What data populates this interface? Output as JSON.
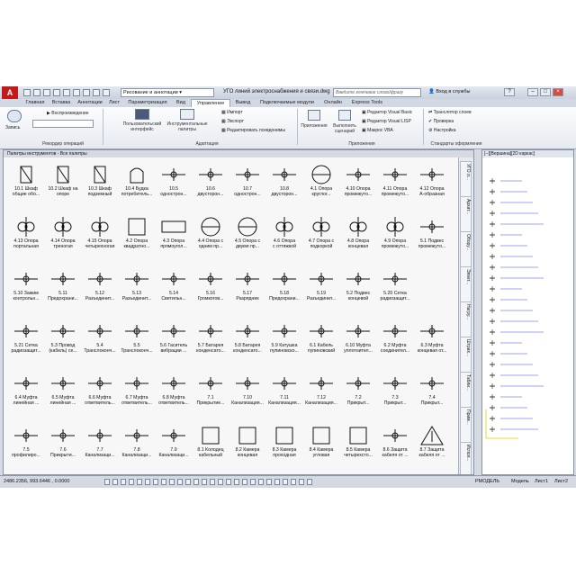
{
  "window": {
    "title": "УГО линий электроснабжения и связи.dwg",
    "workspace": "Рисование и аннотации",
    "search_placeholder": "Введите ключевое слово/фразу",
    "login": "Вход в службы"
  },
  "ribbon_tabs": [
    "Главная",
    "Вставка",
    "Аннотации",
    "Лист",
    "Параметризация",
    "Вид",
    "Управление",
    "Вывод",
    "Подключаемые модули",
    "Онлайн",
    "Express Tools"
  ],
  "active_tab": "Управление",
  "ribbon": {
    "record": "Запись",
    "playback": "Воспроизведение",
    "group_recorder": "Рекордер операций",
    "custom_ui": "Пользовательский интерфейс",
    "tool_palettes": "Инструментальные палитры",
    "import": "Импорт",
    "export": "Экспорт",
    "edit_aliases": "Редактировать псевдонимы",
    "group_adapt": "Адаптация",
    "apps": "Приложения",
    "run_script": "Выполнить сценарий",
    "vb_editor": "Редактор Visual Basic",
    "lisp_editor": "Редактор Visual LISP",
    "vba_macro": "Макрос VBA",
    "group_apps": "Приложения",
    "layer_translator": "Транслятор слоев",
    "check": "Проверка",
    "settings": "Настройка",
    "group_standards": "Стандарты оформления"
  },
  "palette": {
    "title": "Палитры инструментов - Все палитры",
    "side_tabs": [
      "УГО л...",
      "Архит...",
      "Обору...",
      "Элект...",
      "Нагру...",
      "Штрих...",
      "Табли...",
      "Прим...",
      "Испол..."
    ],
    "items": [
      [
        "10.1 Шкаф",
        "общие обо...",
        "box"
      ],
      [
        "10.2 Шкаф на",
        "опоре",
        "box"
      ],
      [
        "10.3 Шкаф",
        "подземный",
        "box"
      ],
      [
        "10.4 Будка",
        "потребитель...",
        "arch"
      ],
      [
        "10.5",
        "однострон...",
        "line"
      ],
      [
        "10.6",
        "двусторон...",
        "line"
      ],
      [
        "10.7",
        "однострон...",
        "line"
      ],
      [
        "10.8",
        "двусторон...",
        "line"
      ],
      [
        "4.1 Опора",
        "круглог...",
        "circle"
      ],
      [
        "4.10 Опора",
        "промежуто...",
        "line"
      ],
      [
        "4.11 Опора",
        "промежуто...",
        "line"
      ],
      [
        "4.12 Опора",
        "А-образная",
        "line"
      ],
      [
        "4.13 Опора",
        "портальная",
        "pole"
      ],
      [
        "4.14 Опора",
        "треногая",
        "pole"
      ],
      [
        "4.15 Опора",
        "четырехногая",
        "pole"
      ],
      [
        "4.2 Опора",
        "квадратно...",
        "square"
      ],
      [
        "4.3 Опора",
        "прямоугол...",
        "rect"
      ],
      [
        "4.4 Опора с",
        "одним пр...",
        "circle"
      ],
      [
        "4.5 Опора с",
        "двумя пр...",
        "circle"
      ],
      [
        "4.6 Опора",
        "с оттяжкой",
        "pole"
      ],
      [
        "4.7 Опора с",
        "подкоркой",
        "pole"
      ],
      [
        "4.8 Опора",
        "концевая",
        "pole"
      ],
      [
        "4.9 Опора",
        "промежуто...",
        "pole"
      ],
      [
        "5.1 Подвес",
        "промежуто...",
        "line"
      ],
      [
        "5.10 Зажим",
        "контрольн...",
        "line"
      ],
      [
        "5.11",
        "Предохрани...",
        "line"
      ],
      [
        "5.12",
        "Разъединит...",
        "line"
      ],
      [
        "5.13",
        "Разъединит...",
        "line"
      ],
      [
        "5.14",
        "Светильн...",
        "line"
      ],
      [
        "5.16",
        "Громкогов...",
        "line"
      ],
      [
        "5.17",
        "Разрядник",
        "line"
      ],
      [
        "5.18",
        "Предохрани...",
        "line"
      ],
      [
        "5.19",
        "Разъединит...",
        "line"
      ],
      [
        "5.2 Подвес",
        "концевой",
        "line"
      ],
      [
        "5.20 Сетка",
        "радиозащит...",
        "line"
      ],
      [
        "",
        "",
        " "
      ],
      [
        "5.21 Сетка",
        "радиозащит...",
        "line"
      ],
      [
        "5.3 Провод",
        "(кабель) се...",
        "line"
      ],
      [
        "5.4",
        "Транслоконч...",
        "line"
      ],
      [
        "5.5",
        "Транслоконч...",
        "line"
      ],
      [
        "5.6 Гаситель",
        "вибрации ...",
        "line"
      ],
      [
        "5.7 Батарея",
        "конденсато...",
        "line"
      ],
      [
        "5.8 Батарея",
        "конденсато...",
        "line"
      ],
      [
        "5.9 Катушка",
        "пупиновско...",
        "line"
      ],
      [
        "6.1 Кабель",
        "пупиновский",
        "line"
      ],
      [
        "6.10 Муфта",
        "уплотнител...",
        "line"
      ],
      [
        "6.2 Муфта",
        "соединител...",
        "line"
      ],
      [
        "6.3 Муфта",
        "концевая от...",
        "line"
      ],
      [
        "6.4 Муфта",
        "линейная ...",
        "line"
      ],
      [
        "6.5 Муфта",
        "линейная ...",
        "line"
      ],
      [
        "6.6 Муфта",
        "ответвитель...",
        "line"
      ],
      [
        "6.7 Муфта",
        "ответвитель...",
        "line"
      ],
      [
        "6.8 Муфта",
        "ответвитель...",
        "line"
      ],
      [
        "7.1",
        "Прикрытие...",
        "line"
      ],
      [
        "7.10",
        "Канализация...",
        "line"
      ],
      [
        "7.11",
        "Канализация...",
        "line"
      ],
      [
        "7.12",
        "Канализация...",
        "line"
      ],
      [
        "7.2",
        "Прикрыт...",
        "line"
      ],
      [
        "7.3",
        "Прикрыт...",
        "line"
      ],
      [
        "7.4",
        "Прикрыт...",
        "line"
      ],
      [
        "7.5",
        "профилиро...",
        "line"
      ],
      [
        "7.6",
        "Прикрыти...",
        "line"
      ],
      [
        "7.7",
        "Канализаци...",
        "line"
      ],
      [
        "7.8",
        "Канализаци...",
        "line"
      ],
      [
        "7.9",
        "Канализаци...",
        "line"
      ],
      [
        "8.1 Колодец",
        "кабельный",
        "square"
      ],
      [
        "8.2 Камера",
        "концевая",
        "square"
      ],
      [
        "8.3 Камера",
        "проходная",
        "square"
      ],
      [
        "8.4 Камера",
        "угловая",
        "square"
      ],
      [
        "8.5 Камера",
        "четырехсто...",
        "square"
      ],
      [
        "8.6 Защита",
        "кабеля от ...",
        "line"
      ],
      [
        "8.7 Защита",
        "кабеля от ...",
        "tri"
      ]
    ]
  },
  "navigator": {
    "header": "[--][Вершина][2D каркас]",
    "lines": 24
  },
  "status": {
    "coords": "2486.2356, 993.6446 , 0.0000",
    "model": "Модель",
    "sheet1": "Лист1",
    "sheet2": "Лист2",
    "rmode": "РМОДЕЛЬ"
  }
}
